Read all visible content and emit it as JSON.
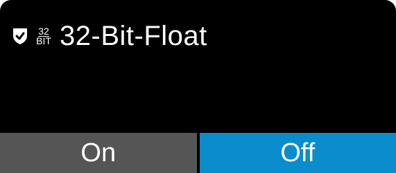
{
  "header": {
    "bit_top": "32",
    "bit_bottom": "BIT",
    "title": "32-Bit-Float"
  },
  "toggle": {
    "on_label": "On",
    "off_label": "Off",
    "selected": "Off"
  },
  "icons": [
    "shield-check-icon",
    "bit-depth-icon"
  ],
  "colors": {
    "background": "#000000",
    "inactive_segment": "#555555",
    "active_segment": "#0a8ccd",
    "text": "#ffffff"
  }
}
